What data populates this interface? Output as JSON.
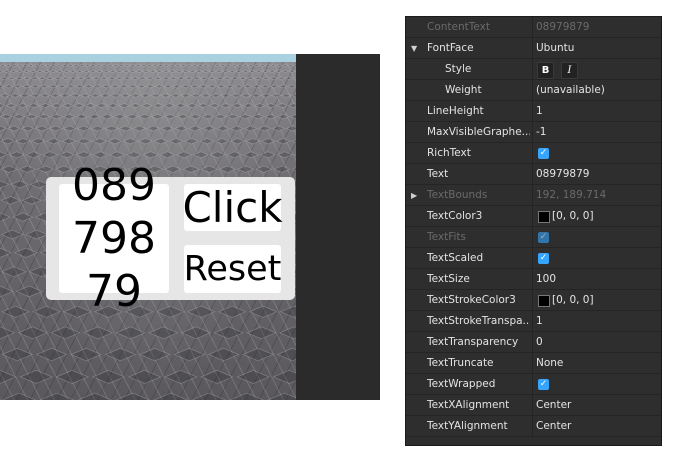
{
  "viewport": {
    "gui": {
      "display_text": "08979879",
      "click_label": "Click",
      "reset_label": "Reset"
    }
  },
  "properties": [
    {
      "name": "ContentText",
      "value": "08979879",
      "kind": "text",
      "dim": true
    },
    {
      "name": "FontFace",
      "value": "Ubuntu",
      "kind": "text",
      "expander": "expanded"
    },
    {
      "name": "Style",
      "kind": "style",
      "indent": true,
      "bold_label": "B",
      "italic_label": "I"
    },
    {
      "name": "Weight",
      "value": "(unavailable)",
      "kind": "text",
      "indent": true
    },
    {
      "name": "LineHeight",
      "value": "1",
      "kind": "text"
    },
    {
      "name": "MaxVisibleGraphe...",
      "value": "-1",
      "kind": "text"
    },
    {
      "name": "RichText",
      "kind": "checkbox",
      "checked": true
    },
    {
      "name": "Text",
      "value": "08979879",
      "kind": "text"
    },
    {
      "name": "TextBounds",
      "value": "192, 189.714",
      "kind": "text",
      "dim": true,
      "expander": "collapsed"
    },
    {
      "name": "TextColor3",
      "value": "[0, 0, 0]",
      "kind": "color",
      "swatch": "#000000"
    },
    {
      "name": "TextFits",
      "kind": "checkbox",
      "checked": true,
      "dim": true
    },
    {
      "name": "TextScaled",
      "kind": "checkbox",
      "checked": true
    },
    {
      "name": "TextSize",
      "value": "100",
      "kind": "text"
    },
    {
      "name": "TextStrokeColor3",
      "value": "[0, 0, 0]",
      "kind": "color",
      "swatch": "#000000"
    },
    {
      "name": "TextStrokeTranspa...",
      "value": "1",
      "kind": "text"
    },
    {
      "name": "TextTransparency",
      "value": "0",
      "kind": "text"
    },
    {
      "name": "TextTruncate",
      "value": "None",
      "kind": "text"
    },
    {
      "name": "TextWrapped",
      "kind": "checkbox",
      "checked": true
    },
    {
      "name": "TextXAlignment",
      "value": "Center",
      "kind": "text"
    },
    {
      "name": "TextYAlignment",
      "value": "Center",
      "kind": "text"
    }
  ],
  "colors": {
    "checkbox": "#35a5ff",
    "panel_bg": "#2e2e2e",
    "sky": "#a9d1df"
  }
}
